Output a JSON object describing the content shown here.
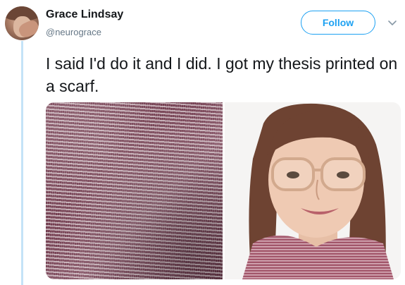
{
  "tweet": {
    "author": {
      "name": "Grace Lindsay",
      "handle": "@neurograce"
    },
    "follow_label": "Follow",
    "text": "I said I'd do it and I did. I got my thesis printed on a scarf.",
    "photos": [
      {
        "subject": "thesis-scarf-closeup"
      },
      {
        "subject": "author-wearing-scarf"
      }
    ]
  },
  "colors": {
    "accent": "#1da1f2",
    "text": "#14171a",
    "muted": "#657786",
    "thread": "#c4e3f7"
  }
}
